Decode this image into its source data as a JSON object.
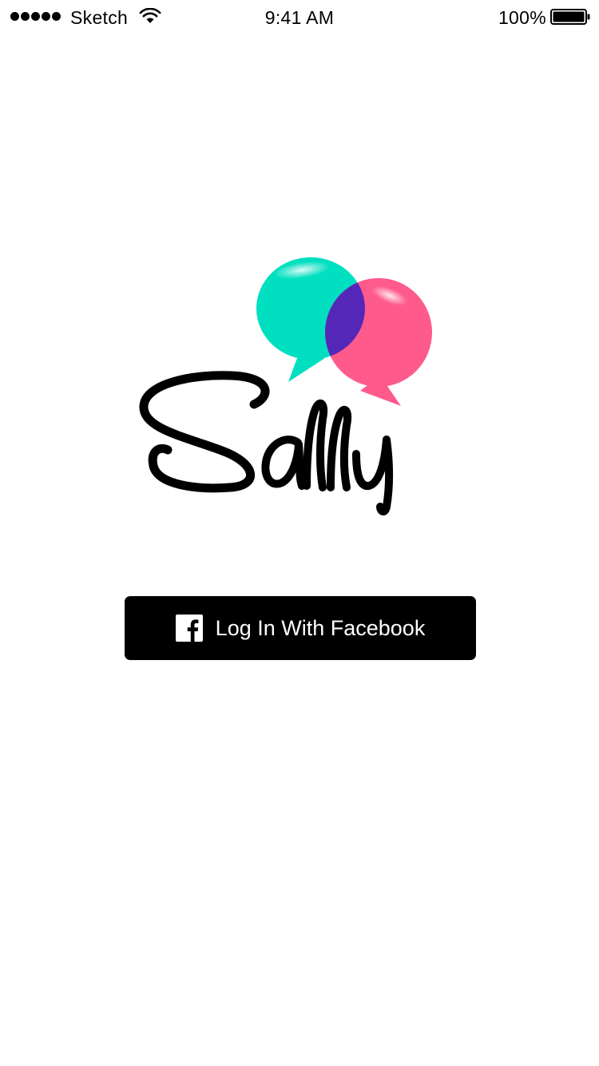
{
  "status_bar": {
    "carrier": "Sketch",
    "time": "9:41 AM",
    "battery_percent": "100%",
    "signal_bars": 5,
    "icons": [
      "signal-dots-icon",
      "wifi-icon",
      "battery-icon"
    ]
  },
  "logo": {
    "wordmark": "Sally",
    "colors": {
      "left_bubble": "#00DFC0",
      "right_bubble": "#FF5A8C",
      "overlap": "#5527B8",
      "wordmark": "#000000"
    }
  },
  "login": {
    "button_label": "Log In With Facebook",
    "icon": "facebook-icon",
    "button_color": "#000000",
    "text_color": "#FFFFFF"
  }
}
